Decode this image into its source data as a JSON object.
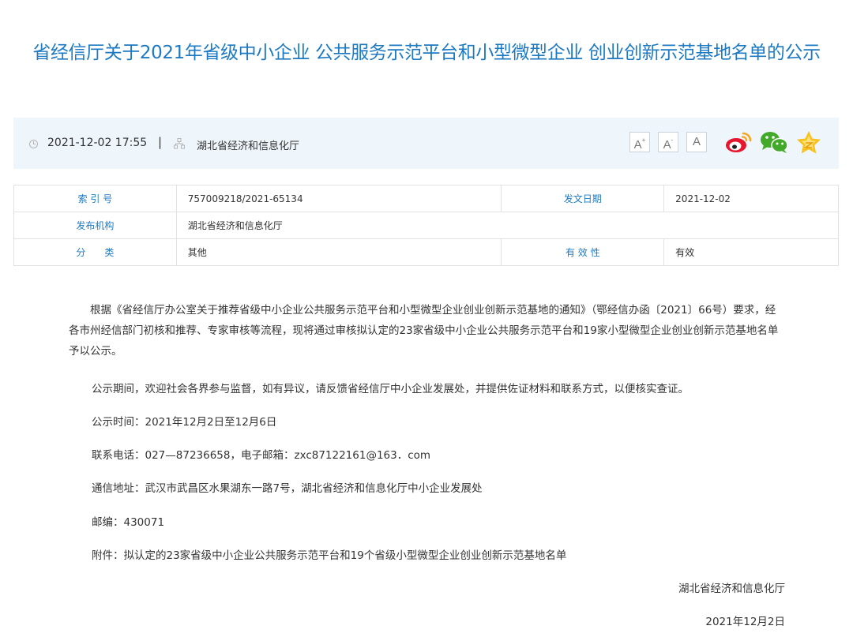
{
  "title": "省经信厅关于2021年省级中小企业 公共服务示范平台和小型微型企业 创业创新示范基地名单的公示",
  "info_bar": {
    "datetime": "2021-12-02 17:55",
    "separator": "|",
    "publisher": "湖北省经济和信息化厅",
    "font_buttons": [
      "A",
      "A",
      "A"
    ],
    "icons": [
      "clock-icon",
      "org-icon",
      "weibo-icon",
      "wechat-icon",
      "favorite-star-icon"
    ]
  },
  "meta": {
    "index_label": "索 引 号",
    "index_value": "757009218/2021-65134",
    "date_label": "发文日期",
    "date_value": "2021-12-02",
    "org_label": "发布机构",
    "org_value": "湖北省经济和信息化厅",
    "category_label": "分　　类",
    "category_value": "其他",
    "validity_label": "有 效 性",
    "validity_value": "有效"
  },
  "content": {
    "para1": "根据《省经信厅办公室关于推荐省级中小企业公共服务示范平台和小型微型企业创业创新示范基地的通知》（鄂经信办函〔2021〕66号）要求，经各市州经信部门初核和推荐、专家审核等流程，现将通过审核拟认定的23家省级中小企业公共服务示范平台和19家小型微型企业创业创新示范基地名单予以公示。",
    "para2": "公示期间，欢迎社会各界参与监督，如有异议，请反馈省经信厅中小企业发展处，并提供佐证材料和联系方式，以便核实查证。",
    "para3": "公示时间：2021年12月2日至12月6日",
    "para4": "联系电话：027—87236658，电子邮箱：zxc87122161@163．com",
    "para5": "通信地址：武汉市武昌区水果湖东一路7号，湖北省经济和信息化厅中小企业发展处",
    "para6": "邮编：430071",
    "para7": "附件：拟认定的23家省级中小企业公共服务示范平台和19个省级小型微型企业创业创新示范基地名单",
    "signature": "湖北省经济和信息化厅",
    "sign_date": "2021年12月2日"
  },
  "colors": {
    "title": "#1d7ac2",
    "info_bar_bg": "#eef5fb",
    "label": "#1d7ac2",
    "weibo_red": "#e6162d",
    "weibo_orange": "#f5a623",
    "wechat_green": "#43a92a",
    "star_yellow": "#f7c21d"
  }
}
